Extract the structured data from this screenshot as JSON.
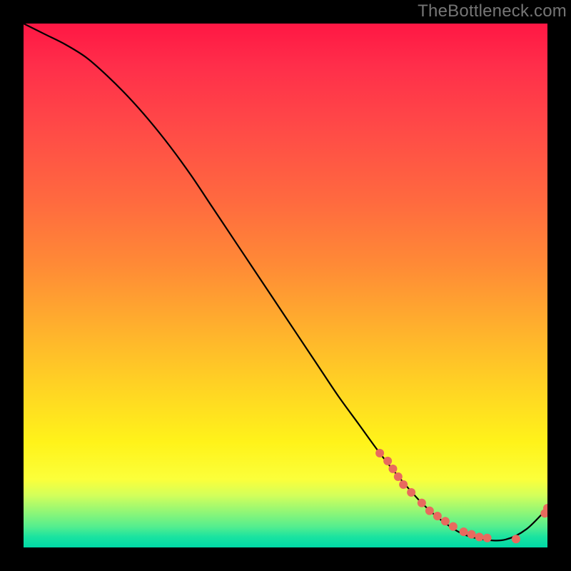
{
  "watermark": "TheBottleneck.com",
  "chart_data": {
    "type": "line",
    "title": "",
    "xlabel": "",
    "ylabel": "",
    "xlim": [
      0,
      100
    ],
    "ylim": [
      0,
      100
    ],
    "grid": false,
    "legend": false,
    "curve": {
      "name": "bottleneck-curve",
      "x": [
        0,
        4,
        8,
        12,
        16,
        20,
        24,
        28,
        32,
        36,
        40,
        44,
        48,
        52,
        56,
        60,
        64,
        68,
        72,
        76,
        80,
        84,
        88,
        92,
        96,
        100
      ],
      "y": [
        100,
        98,
        96,
        93.5,
        90,
        86,
        81.5,
        76.5,
        71,
        65,
        59,
        53,
        47,
        41,
        35,
        29,
        23.5,
        18,
        13,
        8.5,
        5,
        2.5,
        1.5,
        1.5,
        3.5,
        7.5
      ]
    },
    "points": {
      "name": "marked-points",
      "color": "#e86a5e",
      "x": [
        68,
        69.5,
        70.5,
        71.5,
        72.5,
        74,
        76,
        77.5,
        79,
        80.5,
        82,
        84,
        85.5,
        87,
        88.5,
        94,
        99.5,
        100
      ],
      "y": [
        18,
        16.5,
        15,
        13.5,
        12,
        10.5,
        8.5,
        7,
        6,
        5,
        4,
        3,
        2.5,
        2,
        1.8,
        1.6,
        6.5,
        7.5
      ]
    }
  }
}
